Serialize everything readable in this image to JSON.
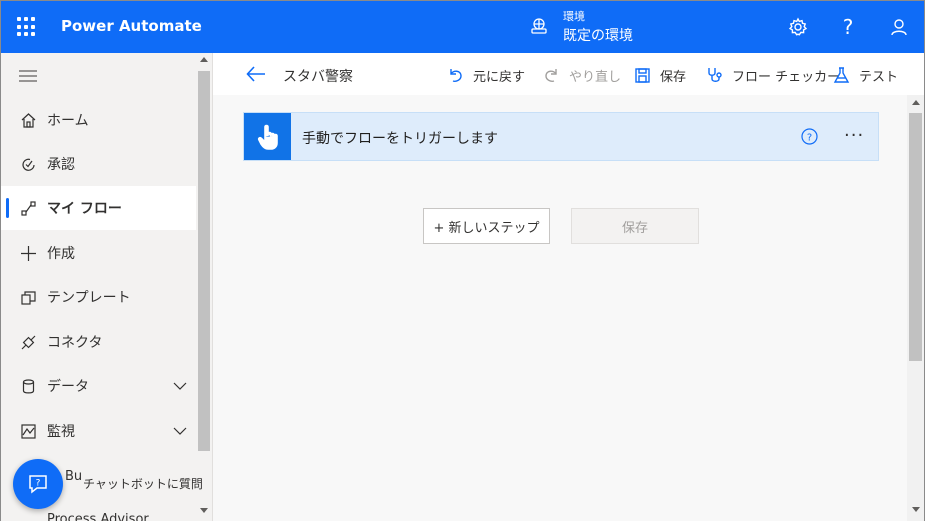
{
  "header": {
    "app_title": "Power Automate",
    "environment_label": "環境",
    "environment_name": "既定の環境",
    "brand_color": "#0f6cf7"
  },
  "sidebar": {
    "items": [
      {
        "label": "ホーム",
        "icon": "home-icon"
      },
      {
        "label": "承認",
        "icon": "approvals-icon"
      },
      {
        "label": "マイ フロー",
        "icon": "flow-icon",
        "active": true
      },
      {
        "label": "作成",
        "icon": "plus-icon"
      },
      {
        "label": "テンプレート",
        "icon": "templates-icon"
      },
      {
        "label": "コネクタ",
        "icon": "connector-icon"
      },
      {
        "label": "データ",
        "icon": "database-icon",
        "expandable": true
      },
      {
        "label": "監視",
        "icon": "monitor-icon",
        "expandable": true
      }
    ],
    "partial_item_text": "Bu",
    "partial_item_bottom": "Process Advisor",
    "chatbot_label": "チャットボットに質問"
  },
  "command_bar": {
    "flow_name": "スタバ警察",
    "undo": "元に戻す",
    "redo": "やり直し",
    "save": "保存",
    "flow_checker": "フロー チェッカー",
    "test": "テスト"
  },
  "canvas": {
    "trigger_title": "手動でフローをトリガーします",
    "more_label": "···",
    "new_step_button": "+ 新しいステップ",
    "save_button": "保存",
    "trigger_color": "#1173e7"
  }
}
